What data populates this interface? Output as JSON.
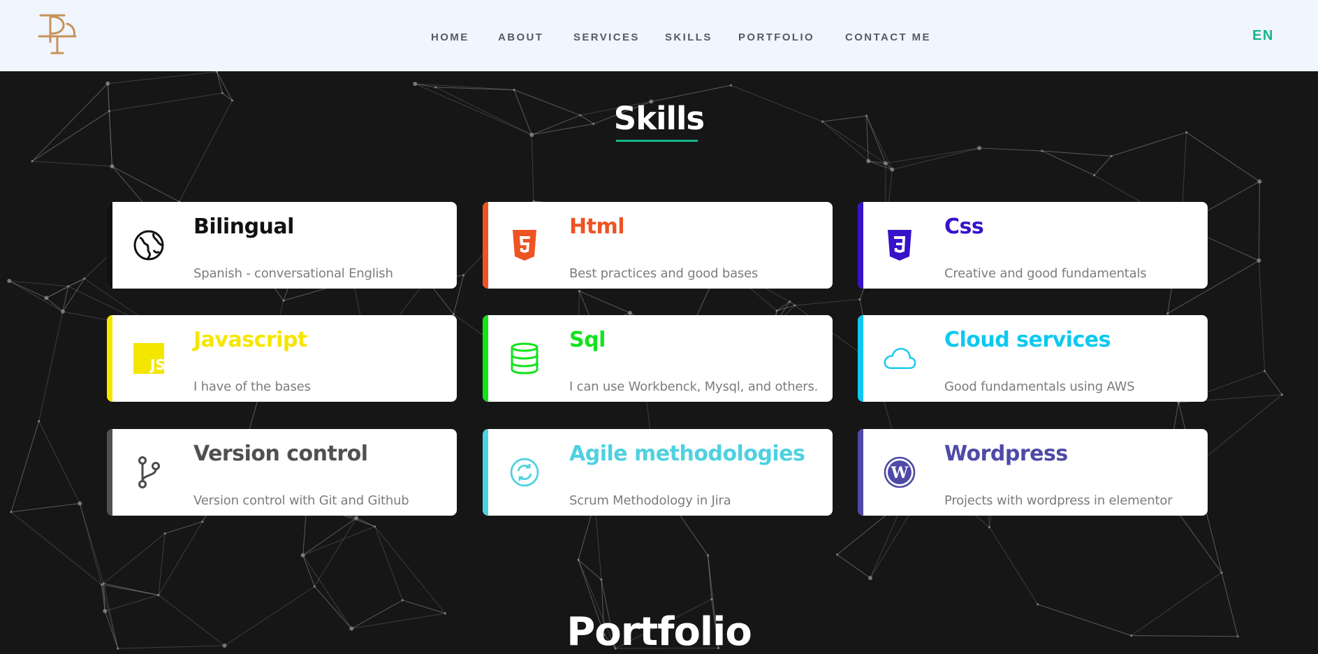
{
  "header": {
    "logo_text": "PT",
    "nav": [
      "HOME",
      "ABOUT",
      "SERVICES",
      "SKILLS",
      "PORTFOLIO",
      "CONTACT ME"
    ],
    "lang": "EN"
  },
  "colors": {
    "header_bg": "#f0f5fe",
    "page_bg": "#161616",
    "accent_green": "#16b38a",
    "logo_gold": "#c8925a"
  },
  "skills": {
    "title": "Skills",
    "items": [
      {
        "title": "Bilingual",
        "desc": "Spanish - conversational English",
        "color": "#111111",
        "icon": "globe-icon"
      },
      {
        "title": "Html",
        "desc": "Best practices and good bases",
        "color": "#ef5322",
        "icon": "html5-icon"
      },
      {
        "title": "Css",
        "desc": "Creative and good fundamentals",
        "color": "#3613c9",
        "icon": "css3-icon"
      },
      {
        "title": "Javascript",
        "desc": "I have of the bases",
        "color": "#f5e600",
        "icon": "javascript-icon"
      },
      {
        "title": "Sql",
        "desc": "I can use Workbenck, Mysql, and others.",
        "color": "#13e31d",
        "icon": "database-icon"
      },
      {
        "title": "Cloud services",
        "desc": "Good fundamentals using AWS",
        "color": "#0fc8f0",
        "icon": "cloud-icon"
      },
      {
        "title": "Version control",
        "desc": "Version control with Git and Github",
        "color": "#505050",
        "icon": "git-branch-icon"
      },
      {
        "title": "Agile methodologies",
        "desc": "Scrum Methodology in Jira",
        "color": "#4fd1e0",
        "icon": "sync-icon"
      },
      {
        "title": "Wordpress",
        "desc": "Projects with wordpress in elementor",
        "color": "#4e4aa6",
        "icon": "wordpress-icon"
      }
    ]
  },
  "portfolio": {
    "title": "Portfolio"
  }
}
